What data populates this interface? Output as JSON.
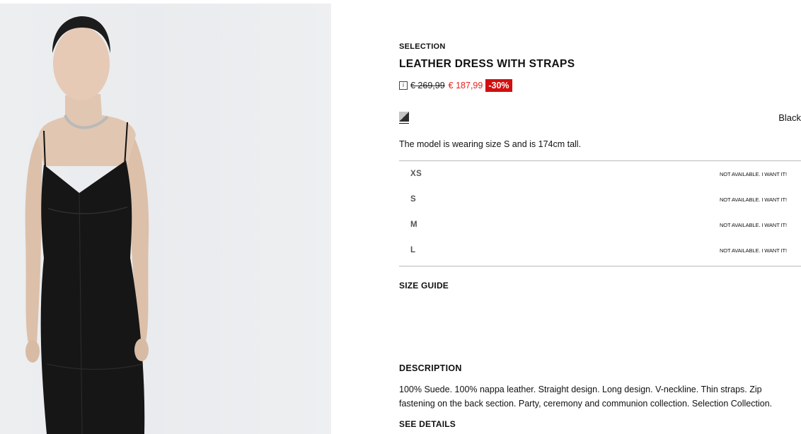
{
  "product": {
    "collection": "SELECTION",
    "title": "LEATHER DRESS WITH STRAPS",
    "price": {
      "info_icon": "i",
      "original": "€ 269,99",
      "sale": "€ 187,99",
      "discount": "-30%"
    },
    "color": {
      "name": "Black",
      "swatch_icon": "color-swatch-icon"
    },
    "model_note": "The model is wearing size S and is 174cm tall.",
    "sizes": [
      {
        "label": "XS",
        "status": "NOT AVAILABLE. I WANT IT!"
      },
      {
        "label": "S",
        "status": "NOT AVAILABLE. I WANT IT!"
      },
      {
        "label": "M",
        "status": "NOT AVAILABLE. I WANT IT!"
      },
      {
        "label": "L",
        "status": "NOT AVAILABLE. I WANT IT!"
      }
    ],
    "size_guide": "SIZE GUIDE",
    "description": {
      "heading": "DESCRIPTION",
      "text": "100% Suede. 100% nappa leather. Straight design. Long design. V-neckline. Thin straps. Zip fastening on the back section. Party, ceremony and communion collection. Selection Collection.",
      "see_details": "SEE DETAILS"
    }
  },
  "colors": {
    "sale_price": "#e1241c",
    "discount_badge": "#d10f0f",
    "photo_background": "#eceef0"
  }
}
